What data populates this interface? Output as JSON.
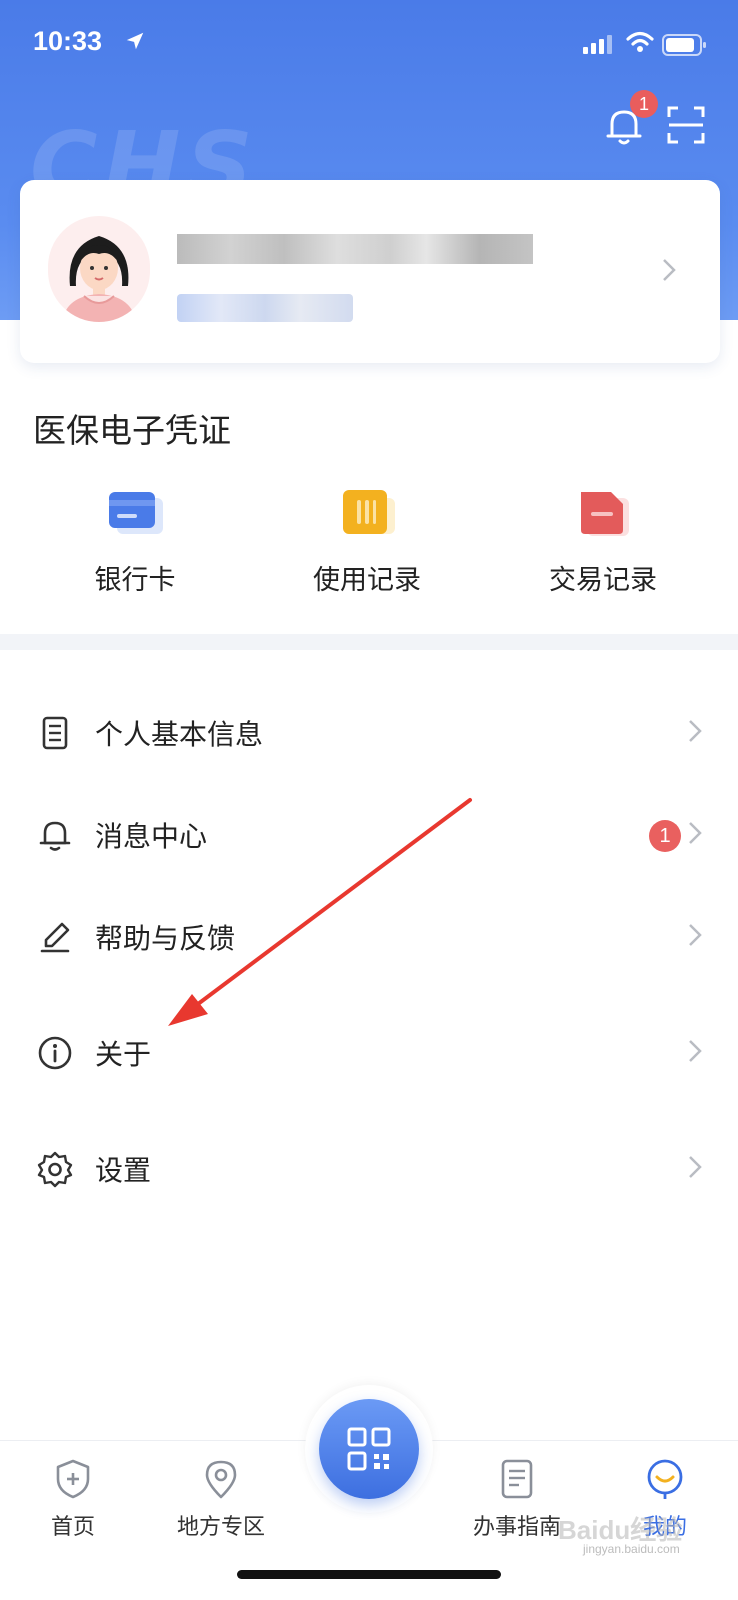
{
  "status_bar": {
    "time": "10:33"
  },
  "header": {
    "watermark_text": "CHS",
    "notification_count": "1"
  },
  "profile": {
    "name_blurred": "",
    "id_blurred": ""
  },
  "voucher_section": {
    "title": "医保电子凭证",
    "items": [
      {
        "label": "银行卡",
        "icon": "bank-card-icon",
        "color": "#4a7be8"
      },
      {
        "label": "使用记录",
        "icon": "usage-record-icon",
        "color": "#f3b11f"
      },
      {
        "label": "交易记录",
        "icon": "transaction-record-icon",
        "color": "#e35b5b"
      }
    ]
  },
  "menu": [
    {
      "label": "个人基本信息",
      "icon": "document-icon"
    },
    {
      "label": "消息中心",
      "icon": "bell-icon",
      "badge": "1"
    },
    {
      "label": "帮助与反馈",
      "icon": "pen-icon"
    },
    {
      "label": "关于",
      "icon": "info-icon"
    },
    {
      "label": "设置",
      "icon": "gear-icon"
    }
  ],
  "tabbar": [
    {
      "label": "首页",
      "icon": "shield-plus-icon"
    },
    {
      "label": "地方专区",
      "icon": "location-pin-icon"
    },
    {
      "label": "",
      "icon": "qr-code-icon"
    },
    {
      "label": "办事指南",
      "icon": "guide-document-icon"
    },
    {
      "label": "我的",
      "icon": "profile-smile-icon",
      "active": true
    }
  ],
  "annotation": {
    "arrow_color": "#e8382f"
  },
  "watermark": {
    "text": "Baidu经验",
    "sub": "jingyan.baidu.com"
  },
  "colors": {
    "primary": "#3a6ee3",
    "header": "#4a7be8",
    "badge": "#e95d5d"
  }
}
